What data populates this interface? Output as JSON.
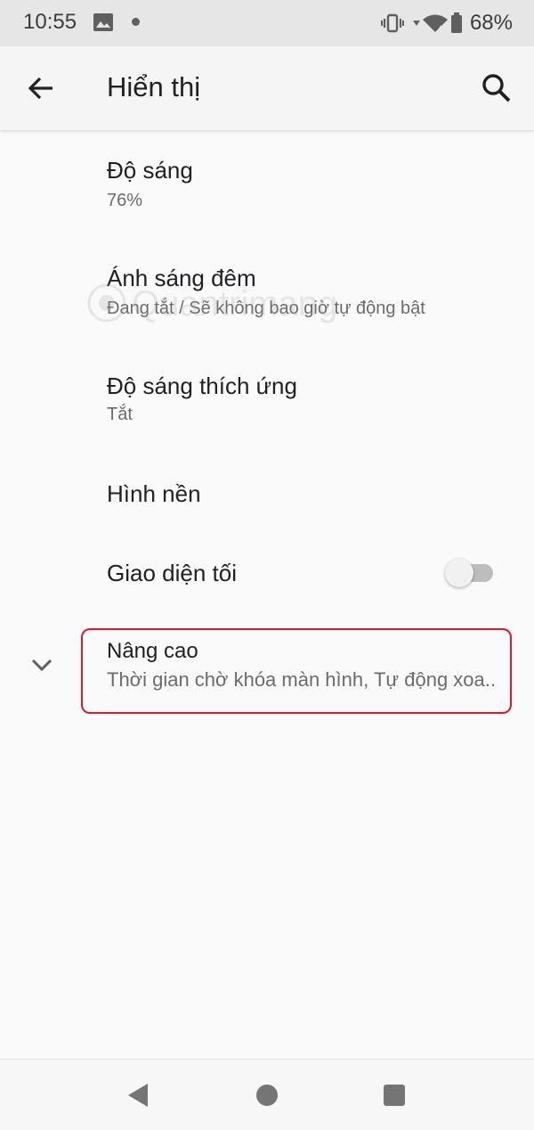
{
  "status_bar": {
    "time": "10:55",
    "battery": "68%",
    "icons": [
      "photo-icon",
      "notification-dot",
      "vibrate-icon",
      "wifi-icon",
      "signal-icon",
      "battery-icon"
    ]
  },
  "header": {
    "title": "Hiển thị",
    "back_icon": "arrow-left-icon",
    "search_icon": "search-icon"
  },
  "settings": {
    "brightness": {
      "title": "Độ sáng",
      "value": "76%"
    },
    "night_light": {
      "title": "Ánh sáng đêm",
      "summary": "Đang tắt / Sẽ không bao giờ tự động bật"
    },
    "adaptive_brightness": {
      "title": "Độ sáng thích ứng",
      "value": "Tắt"
    },
    "wallpaper": {
      "title": "Hình nền"
    },
    "dark_theme": {
      "title": "Giao diện tối",
      "enabled": false
    },
    "advanced": {
      "title": "Nâng cao",
      "summary": "Thời gian chờ khóa màn hình, Tự động xoa..",
      "highlighted": true,
      "highlight_color": "#e0182d"
    }
  },
  "watermark": {
    "text": "Quantrimang"
  },
  "nav_bar": {
    "icons": [
      "back-triangle-icon",
      "home-circle-icon",
      "recents-square-icon"
    ]
  }
}
